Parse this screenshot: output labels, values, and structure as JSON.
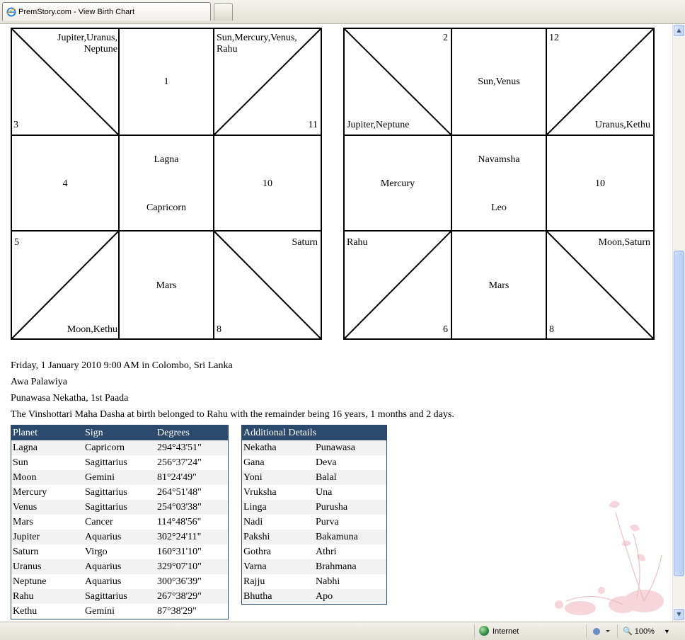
{
  "browser": {
    "tab_title": "PremStory.com - View Birth Chart",
    "status_zone": "Internet",
    "zoom": "100%"
  },
  "rasi_chart": {
    "cells": {
      "top_left_planets": "Jupiter,Uranus,\nNeptune",
      "top_left_num": "3",
      "top_center": "1",
      "top_right_planets": "Sun,Mercury,Venus,\nRahu",
      "top_right_num": "11",
      "mid_left": "4",
      "center_title": "Lagna",
      "center_sign": "Capricorn",
      "mid_right": "10",
      "bot_left_num": "5",
      "bot_left_planets": "Moon,Kethu",
      "bot_center": "Mars",
      "bot_right_planets": "Saturn",
      "bot_right_num": "8"
    }
  },
  "navamsha_chart": {
    "cells": {
      "top_left_num": "2",
      "top_left_planets": "Jupiter,Neptune",
      "top_center": "Sun,Venus",
      "top_right_num": "12",
      "top_right_planets": "Uranus,Kethu",
      "mid_left": "Mercury",
      "center_title": "Navamsha",
      "center_sign": "Leo",
      "mid_right": "10",
      "bot_left_planets": "Rahu",
      "bot_left_num": "6",
      "bot_center": "Mars",
      "bot_right_planets": "Moon,Saturn",
      "bot_right_num": "8"
    }
  },
  "info": {
    "line1": "Friday, 1 January 2010 9:00 AM in Colombo, Sri Lanka",
    "line2": "Awa Palawiya",
    "line3": "Punawasa Nekatha, 1st Paada",
    "line4": "The Vinshottari Maha Dasha at birth belonged to Rahu with the remainder being 16 years, 1 months and 2 days."
  },
  "planets_table": {
    "headers": [
      "Planet",
      "Sign",
      "Degrees"
    ],
    "rows": [
      [
        "Lagna",
        "Capricorn",
        "294°43'51\""
      ],
      [
        "Sun",
        "Sagittarius",
        "256°37'24\""
      ],
      [
        "Moon",
        "Gemini",
        "81°24'49\""
      ],
      [
        "Mercury",
        "Sagittarius",
        "264°51'48\""
      ],
      [
        "Venus",
        "Sagittarius",
        "254°03'38\""
      ],
      [
        "Mars",
        "Cancer",
        "114°48'56\""
      ],
      [
        "Jupiter",
        "Aquarius",
        "302°24'11\""
      ],
      [
        "Saturn",
        "Virgo",
        "160°31'10\""
      ],
      [
        "Uranus",
        "Aquarius",
        "329°07'10\""
      ],
      [
        "Neptune",
        "Aquarius",
        "300°36'39\""
      ],
      [
        "Rahu",
        "Sagittarius",
        "267°38'29\""
      ],
      [
        "Kethu",
        "Gemini",
        "87°38'29\""
      ]
    ]
  },
  "details_table": {
    "header": "Additional Details",
    "rows": [
      [
        "Nekatha",
        "Punawasa"
      ],
      [
        "Gana",
        "Deva"
      ],
      [
        "Yoni",
        "Balal"
      ],
      [
        "Vruksha",
        "Una"
      ],
      [
        "Linga",
        "Purusha"
      ],
      [
        "Nadi",
        "Purva"
      ],
      [
        "Pakshi",
        "Bakamuna"
      ],
      [
        "Gothra",
        "Athri"
      ],
      [
        "Varna",
        "Brahmana"
      ],
      [
        "Rajju",
        "Nabhi"
      ],
      [
        "Bhutha",
        "Apo"
      ]
    ]
  },
  "colors": {
    "table_header": "#2c4a6b",
    "row_alt": "#f2f2f2"
  }
}
